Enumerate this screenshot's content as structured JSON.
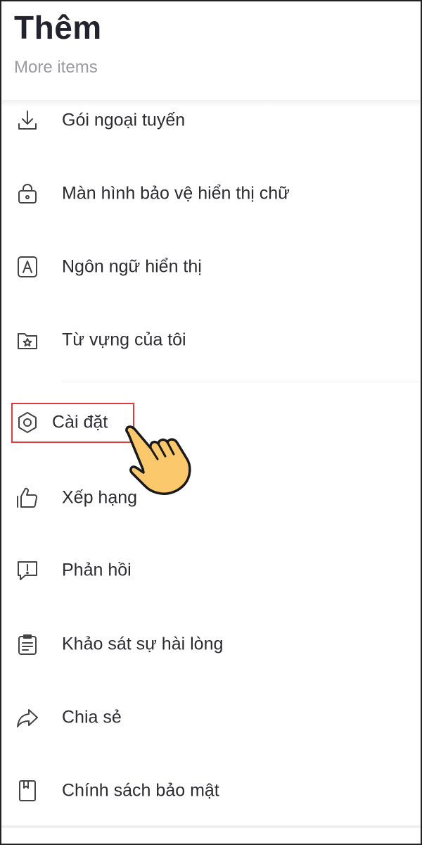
{
  "header": {
    "title": "Thêm",
    "subtitle": "More items"
  },
  "menu": {
    "items": [
      {
        "label": "Gói ngoại tuyến",
        "icon": "download-icon"
      },
      {
        "label": "Màn hình bảo vệ hiển thị chữ",
        "icon": "lock-screen-icon"
      },
      {
        "label": "Ngôn ngữ hiển thị",
        "icon": "language-icon"
      },
      {
        "label": "Từ vựng của tôi",
        "icon": "folder-star-icon"
      },
      {
        "label": "Cài đặt",
        "icon": "settings-icon"
      },
      {
        "label": "Xếp hạng",
        "icon": "thumbs-up-icon"
      },
      {
        "label": "Phản hồi",
        "icon": "feedback-icon"
      },
      {
        "label": "Khảo sát sự hài lòng",
        "icon": "survey-icon"
      },
      {
        "label": "Chia sẻ",
        "icon": "share-icon"
      },
      {
        "label": "Chính sách bảo mật",
        "icon": "privacy-book-icon"
      }
    ]
  },
  "annotation": {
    "highlight_color": "#e03a3a",
    "pointer": "pointing-hand-icon"
  }
}
